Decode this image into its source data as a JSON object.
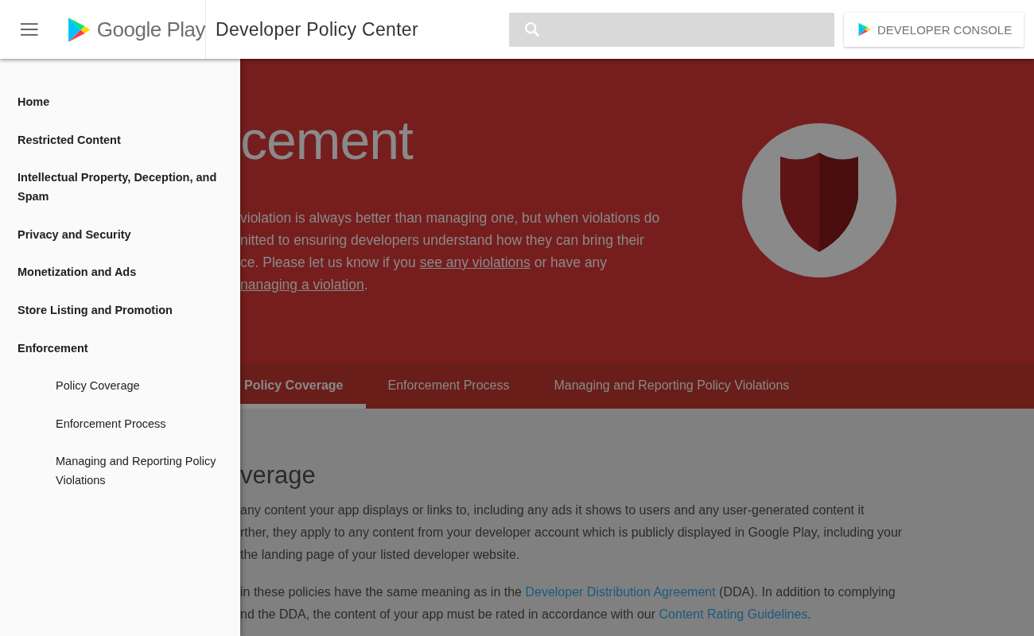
{
  "header": {
    "brand": "Google Play",
    "title": "Developer Policy Center",
    "console_button": "DEVELOPER CONSOLE"
  },
  "drawer": {
    "items": [
      {
        "label": "Home"
      },
      {
        "label": "Restricted Content"
      },
      {
        "label": "Intellectual Property, Deception, and Spam"
      },
      {
        "label": "Privacy and Security"
      },
      {
        "label": "Monetization and Ads"
      },
      {
        "label": "Store Listing and Promotion"
      },
      {
        "label": "Enforcement",
        "children": [
          {
            "label": "Policy Coverage"
          },
          {
            "label": "Enforcement Process"
          },
          {
            "label": "Managing and Reporting Policy Violations"
          }
        ]
      }
    ]
  },
  "hero": {
    "title": "cement",
    "lines": [
      [
        {
          "text": "violation is always better than managing one, but when violations do",
          "link": false
        }
      ],
      [
        {
          "text": "nitted to ensuring developers understand how they can bring their",
          "link": false
        }
      ],
      [
        {
          "text": "ce. Please let us know if you ",
          "link": false
        },
        {
          "text": "see any violations",
          "link": true
        },
        {
          "text": " or have any",
          "link": false
        }
      ],
      [
        {
          "text": "nanaging a violation",
          "link": true
        },
        {
          "text": ".",
          "link": false
        }
      ]
    ]
  },
  "tabs": [
    {
      "label": "Policy Coverage",
      "selected": true
    },
    {
      "label": "Enforcement Process",
      "selected": false
    },
    {
      "label": "Managing and Reporting Policy Violations",
      "selected": false
    }
  ],
  "section": {
    "heading": "verage",
    "paragraphs": [
      [
        [
          {
            "text": " any content your app displays or links to, including any ads it shows to users and any user-generated content it",
            "link": false
          }
        ],
        [
          {
            "text": "rther, they apply to any content from your developer account which is publicly displayed in Google Play, including your",
            "link": false
          }
        ],
        [
          {
            "text": " the landing page of your listed developer website.",
            "link": false
          }
        ]
      ],
      [
        [
          {
            "text": "in these policies have the same meaning as in the ",
            "link": false
          },
          {
            "text": "Developer Distribution Agreement",
            "link": true
          },
          {
            "text": " (DDA). In addition to complying",
            "link": false
          }
        ],
        [
          {
            "text": "nd the DDA, the content of your app must be rated in accordance with our ",
            "link": false
          },
          {
            "text": "Content Rating Guidelines",
            "link": true
          },
          {
            "text": ".",
            "link": false
          }
        ]
      ]
    ]
  }
}
